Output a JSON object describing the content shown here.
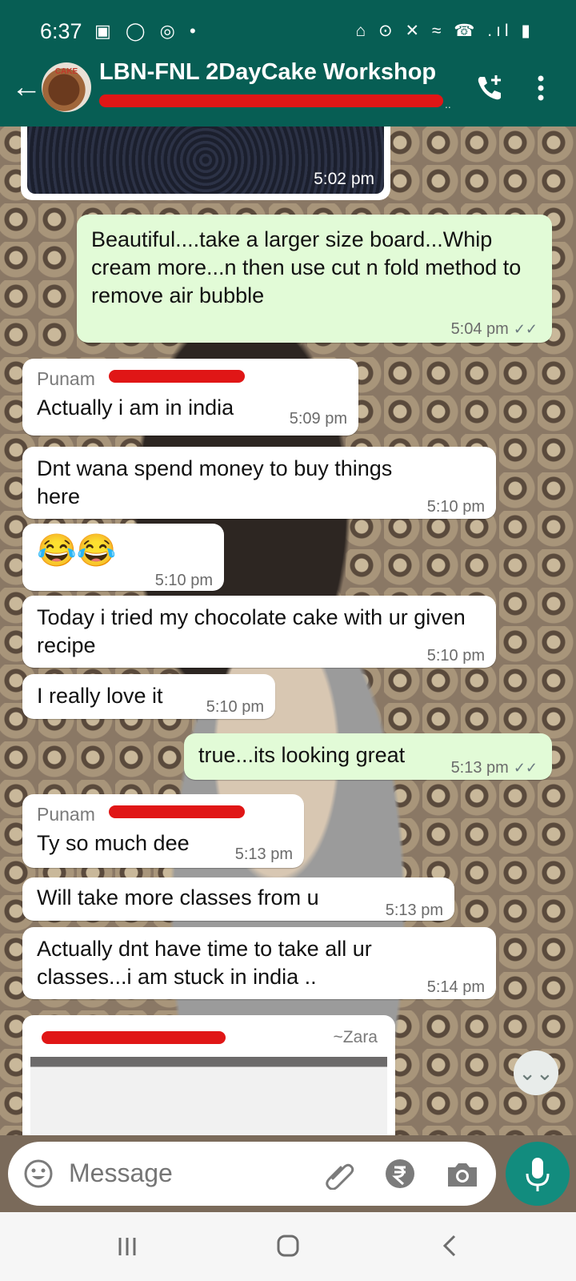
{
  "status_bar": {
    "time": "6:37",
    "left_icons": "▣ ◯ ◎ •",
    "right_icons": "⌂ ⊙ ✕ ≈ ☎ .ıl ▮"
  },
  "header": {
    "title": "LBN-FNL 2DayCake Workshop",
    "subtitle_overflow": "..",
    "avatar_text": "CAKE",
    "back_icon": "arrow-left",
    "call_icon": "add-call",
    "menu_icon": "more-vertical"
  },
  "messages": [
    {
      "type": "image-tail",
      "direction": "in",
      "time": "5:02 pm"
    },
    {
      "direction": "out",
      "text": "Beautiful....take a larger size board...Whip cream more...n then use cut n fold method to remove air bubble",
      "time": "5:04 pm",
      "ticks": "✓✓"
    },
    {
      "direction": "in",
      "sender": "Punam",
      "text": "Actually i am in india",
      "time": "5:09 pm"
    },
    {
      "direction": "in",
      "text": "Dnt wana spend money to buy things here",
      "time": "5:10 pm"
    },
    {
      "direction": "in",
      "text": "😂😂",
      "time": "5:10 pm"
    },
    {
      "direction": "in",
      "text": "Today i tried my chocolate cake with ur given recipe",
      "time": "5:10 pm"
    },
    {
      "direction": "in",
      "text": "I really love it",
      "time": "5:10 pm"
    },
    {
      "direction": "out",
      "text": "true...its looking great",
      "time": "5:13 pm",
      "ticks": "✓✓"
    },
    {
      "direction": "in",
      "sender": "Punam",
      "text": "Ty so much dee",
      "time": "5:13 pm"
    },
    {
      "direction": "in",
      "text": "Will take more classes from u",
      "time": "5:13 pm"
    },
    {
      "direction": "in",
      "text": "Actually dnt have time to take all ur classes...i am stuck in india ..",
      "time": "5:14 pm"
    },
    {
      "type": "image",
      "direction": "in",
      "sender_alias": "~Zara"
    }
  ],
  "composer": {
    "placeholder": "Message",
    "scroll_icon": "⌄⌄"
  },
  "colors": {
    "header": "#075e54",
    "outgoing_bubble": "#e2fbd7",
    "incoming_bubble": "#ffffff",
    "mic_button": "#128c7e",
    "redaction": "#e01616"
  }
}
